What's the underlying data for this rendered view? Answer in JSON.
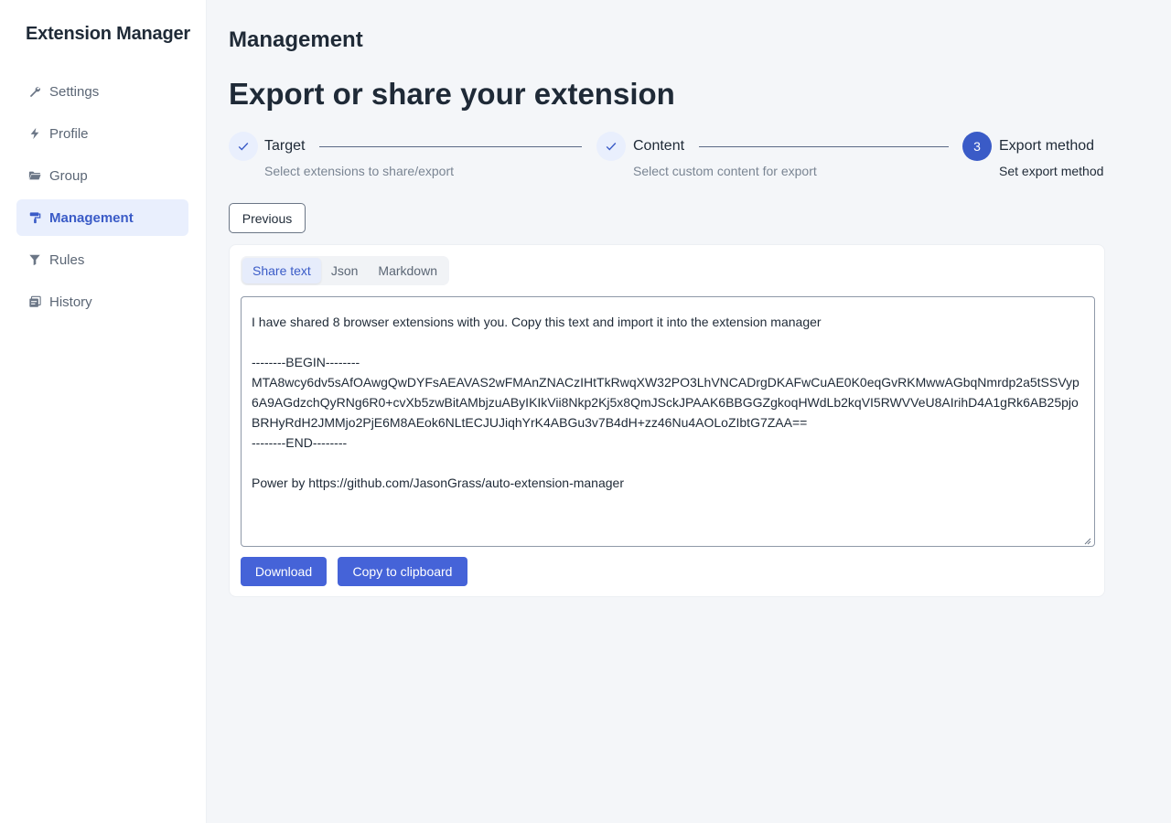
{
  "sidebar": {
    "app_title": "Extension Manager",
    "items": [
      {
        "label": "Settings",
        "icon": "wrench-icon"
      },
      {
        "label": "Profile",
        "icon": "bolt-icon"
      },
      {
        "label": "Group",
        "icon": "folder-icon"
      },
      {
        "label": "Management",
        "icon": "paint-roller-icon",
        "active": true
      },
      {
        "label": "Rules",
        "icon": "filter-icon"
      },
      {
        "label": "History",
        "icon": "history-icon"
      }
    ]
  },
  "main": {
    "section_title": "Management",
    "page_title": "Export or share your extension",
    "steps": [
      {
        "label": "Target",
        "description": "Select extensions to share/export",
        "status": "done"
      },
      {
        "label": "Content",
        "description": "Select custom content for export",
        "status": "done"
      },
      {
        "label": "Export method",
        "description": "Set export method",
        "status": "current",
        "number": "3"
      }
    ],
    "previous_label": "Previous",
    "tabs": [
      {
        "label": "Share text",
        "active": true
      },
      {
        "label": "Json"
      },
      {
        "label": "Markdown"
      }
    ],
    "share_text": "I have shared 8 browser extensions with you. Copy this text and import it into the extension manager\n\n--------BEGIN--------\nMTA8wcy6dv5sAfOAwgQwDYFsAEAVAS2wFMAnZNACzIHtTkRwqXW32PO3LhVNCADrgDKAFwCuAE0K0eqGvRKMwwAGbqNmrdp2a5tSSVyp6A9AGdzchQyRNg6R0+cvXb5zwBitAMbjzuAByIKIkVii8Nkp2Kj5x8QmJSckJPAAK6BBGGZgkoqHWdLb2kqVI5RWVVeU8AIrihD4A1gRk6AB25pjoBRHyRdH2JMMjo2PjE6M8AEok6NLtECJUJiqhYrK4ABGu3v7B4dH+zz46Nu4AOLoZIbtG7ZAA==\n--------END--------\n\nPower by https://github.com/JasonGrass/auto-extension-manager",
    "download_label": "Download",
    "copy_label": "Copy to clipboard"
  },
  "colors": {
    "accent": "#3a5bc7",
    "button": "#4563d8",
    "active_bg": "#e9effd"
  }
}
